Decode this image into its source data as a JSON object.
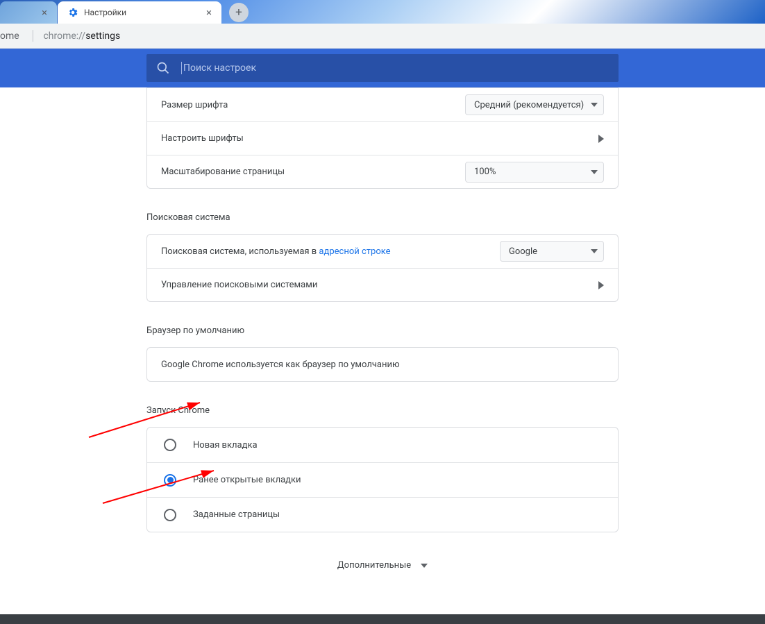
{
  "tabs": {
    "active_title": "Настройки"
  },
  "address": {
    "home": "ome",
    "url_gray": "chrome://",
    "url_dark": "settings"
  },
  "search": {
    "placeholder": "Поиск настроек"
  },
  "appearance": {
    "font_size_label": "Размер шрифта",
    "font_size_value": "Средний (рекомендуется)",
    "customize_fonts_label": "Настроить шрифты",
    "page_zoom_label": "Масштабирование страницы",
    "page_zoom_value": "100%"
  },
  "search_engine": {
    "section_title": "Поисковая система",
    "row1_prefix": "Поисковая система, используемая в ",
    "row1_link": "адресной строке",
    "row1_value": "Google",
    "row2_label": "Управление поисковыми системами"
  },
  "default_browser": {
    "section_title": "Браузер по умолчанию",
    "text": "Google Chrome используется как браузер по умолчанию"
  },
  "startup": {
    "section_title": "Запуск Chrome",
    "options": [
      {
        "label": "Новая вкладка",
        "checked": false
      },
      {
        "label": "Ранее открытые вкладки",
        "checked": true
      },
      {
        "label": "Заданные страницы",
        "checked": false
      }
    ]
  },
  "advanced_label": "Дополнительные"
}
